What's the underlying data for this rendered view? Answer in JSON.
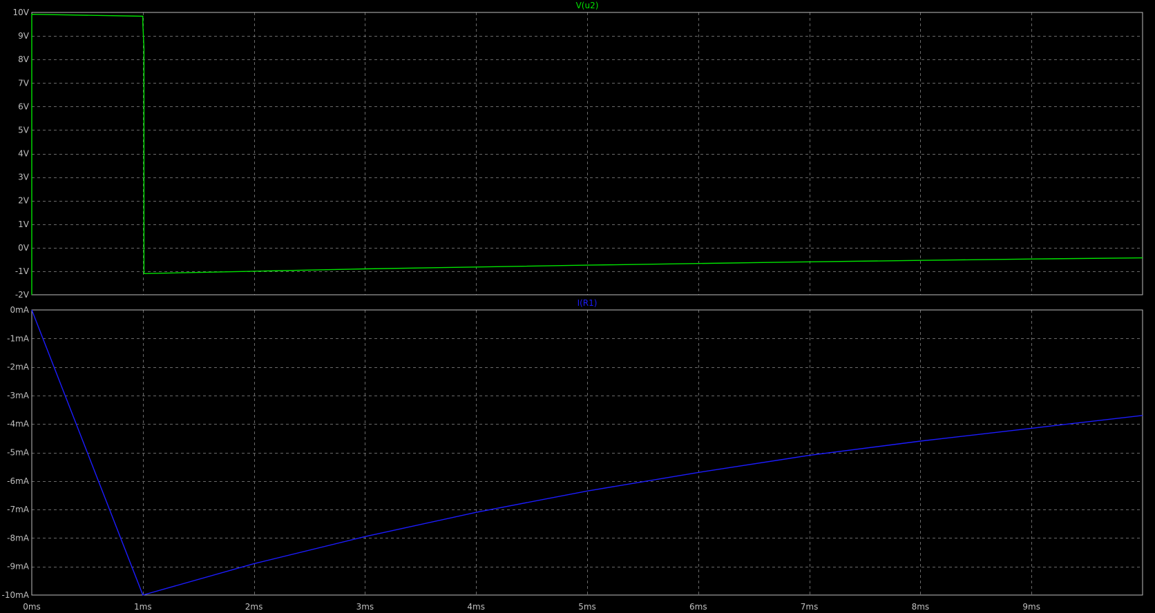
{
  "colors": {
    "background": "#000000",
    "frame": "#c0c0c0",
    "grid": "#6b6b6b",
    "tick_text": "#c0c0c0"
  },
  "chart_data": [
    {
      "type": "line",
      "title": "V(u2)",
      "series": [
        {
          "name": "V(u2)",
          "color": "#00e400",
          "x": [
            0,
            0.0001,
            1.0,
            1.0,
            1.01,
            1.01,
            2,
            3,
            4,
            5,
            6,
            7,
            8,
            9,
            10
          ],
          "y": [
            -2,
            9.92,
            9.84,
            9.5,
            8.5,
            -1.1,
            -1.0,
            -0.9,
            -0.82,
            -0.74,
            -0.67,
            -0.6,
            -0.54,
            -0.48,
            -0.43
          ]
        }
      ],
      "x_ticks": [
        "0ms",
        "1ms",
        "2ms",
        "3ms",
        "4ms",
        "5ms",
        "6ms",
        "7ms",
        "8ms",
        "9ms"
      ],
      "x_tick_values": [
        0,
        1,
        2,
        3,
        4,
        5,
        6,
        7,
        8,
        9
      ],
      "xlim": [
        0,
        10
      ],
      "y_ticks": [
        "10V",
        "9V",
        "8V",
        "7V",
        "6V",
        "5V",
        "4V",
        "3V",
        "2V",
        "1V",
        "0V",
        "-1V",
        "-2V"
      ],
      "y_tick_values": [
        10,
        9,
        8,
        7,
        6,
        5,
        4,
        3,
        2,
        1,
        0,
        -1,
        -2
      ],
      "ylim": [
        -2,
        10
      ],
      "grid": true
    },
    {
      "type": "line",
      "title": "I(R1)",
      "series": [
        {
          "name": "I(R1)",
          "color": "#1c1cff",
          "x": [
            0,
            1.0,
            2,
            3,
            4,
            5,
            6,
            7,
            8,
            9,
            10
          ],
          "y": [
            0,
            -10,
            -8.9,
            -7.95,
            -7.1,
            -6.35,
            -5.7,
            -5.1,
            -4.6,
            -4.15,
            -3.7
          ]
        }
      ],
      "x_ticks": [
        "0ms",
        "1ms",
        "2ms",
        "3ms",
        "4ms",
        "5ms",
        "6ms",
        "7ms",
        "8ms",
        "9ms"
      ],
      "x_tick_values": [
        0,
        1,
        2,
        3,
        4,
        5,
        6,
        7,
        8,
        9
      ],
      "xlim": [
        0,
        10
      ],
      "y_ticks": [
        "0mA",
        "-1mA",
        "-2mA",
        "-3mA",
        "-4mA",
        "-5mA",
        "-6mA",
        "-7mA",
        "-8mA",
        "-9mA",
        "-10mA"
      ],
      "y_tick_values": [
        0,
        -1,
        -2,
        -3,
        -4,
        -5,
        -6,
        -7,
        -8,
        -9,
        -10
      ],
      "ylim": [
        -10,
        0
      ],
      "grid": true
    }
  ]
}
